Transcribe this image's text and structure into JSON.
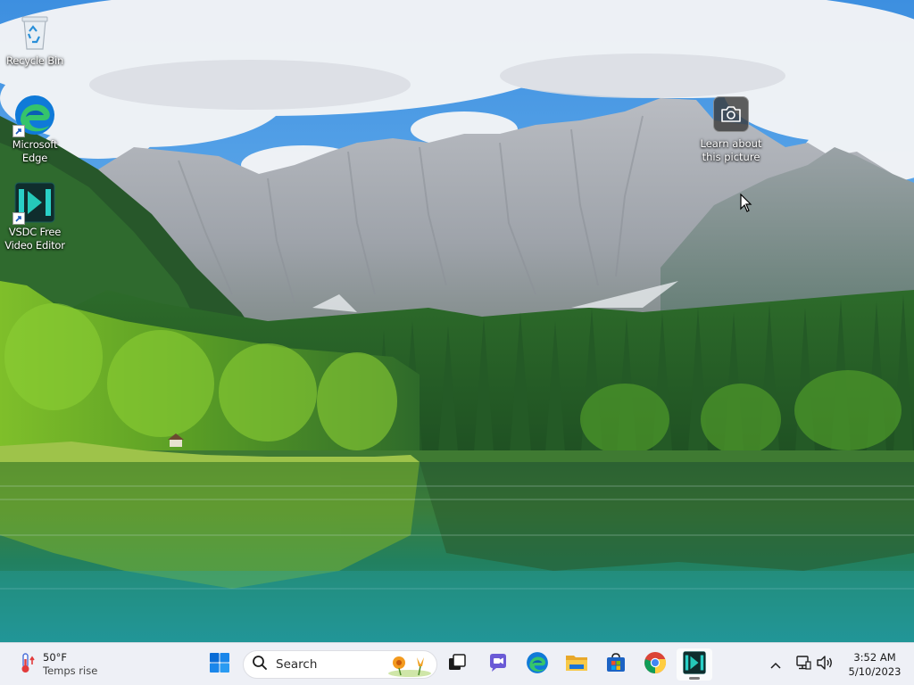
{
  "desktop": {
    "icons": [
      {
        "label": "Recycle Bin"
      },
      {
        "label": "Microsoft Edge"
      },
      {
        "label": "VSDC Free Video Editor"
      }
    ],
    "learn_label": "Learn about this picture"
  },
  "taskbar": {
    "weather": {
      "temp": "50°F",
      "text": "Temps rise"
    },
    "search": {
      "placeholder": "Search"
    },
    "pinned": [
      "start-icon",
      "search",
      "task-view-icon",
      "teams-chat-icon",
      "edge-icon",
      "file-explorer-icon",
      "microsoft-store-icon",
      "chrome-icon",
      "vsdc-icon"
    ],
    "active_app": "vsdc-icon",
    "tray": {
      "time": "3:52 AM",
      "date": "5/10/2023"
    }
  },
  "colors": {
    "taskbar_bg": "#eef0f6",
    "start_blue": "#0a6cd6",
    "sky": "#2f8fe0",
    "lake": "#1f8a86"
  }
}
